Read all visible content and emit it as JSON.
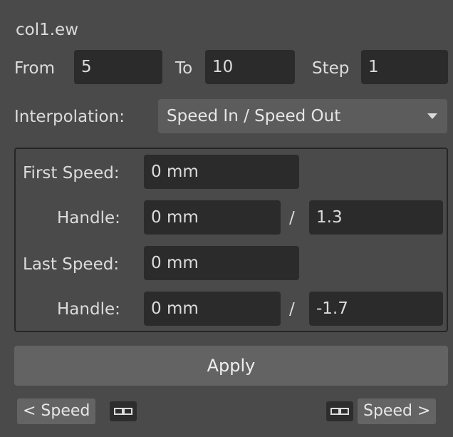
{
  "title": "col1.ew",
  "range": {
    "from_label": "From",
    "from_value": "5",
    "to_label": "To",
    "to_value": "10",
    "step_label": "Step",
    "step_value": "1"
  },
  "interpolation": {
    "label": "Interpolation:",
    "value": "Speed In / Speed Out"
  },
  "speed": {
    "first_label": "First Speed:",
    "first_value": "0 mm",
    "handle1_label": "Handle:",
    "handle1_value": "0 mm",
    "handle1_sep": "/",
    "handle1_ratio": "1.3",
    "last_label": "Last Speed:",
    "last_value": "0 mm",
    "handle2_label": "Handle:",
    "handle2_value": "0 mm",
    "handle2_sep": "/",
    "handle2_ratio": "-1.7"
  },
  "apply_label": "Apply",
  "bottom": {
    "prev_speed_label": "< Speed",
    "next_speed_label": "Speed >",
    "link_icon_glyph": "⊡⊡"
  },
  "colors": {
    "background": "#4a4a4a",
    "field": "#2b2b2b",
    "button": "#636363"
  }
}
